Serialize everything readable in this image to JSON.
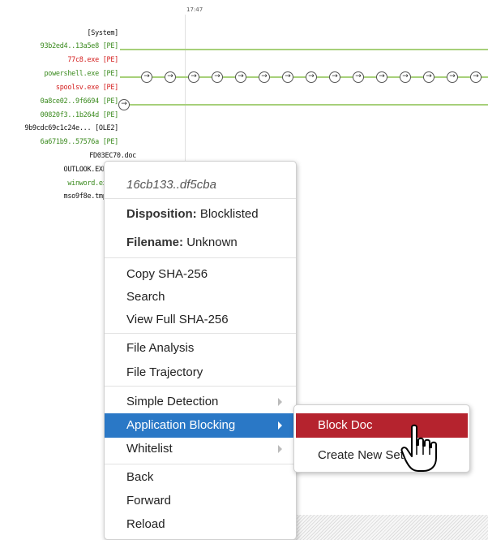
{
  "timeline": {
    "time": "17:47",
    "labels": [
      {
        "text": "[System]",
        "color": "black"
      },
      {
        "text": "93b2ed4..13a5e8 [PE]",
        "color": "green"
      },
      {
        "text": "77c8.exe [PE]",
        "color": "red"
      },
      {
        "text": "powershell.exe [PE]",
        "color": "green"
      },
      {
        "text": "spoolsv.exe [PE]",
        "color": "red"
      },
      {
        "text": "0a8ce02..9f6694 [PE]",
        "color": "green"
      },
      {
        "text": "00820f3..1b264d [PE]",
        "color": "green"
      },
      {
        "text": "9b9cdc69c1c24e... [OLE2]",
        "color": "black"
      },
      {
        "text": "6a671b9..57576a [PE]",
        "color": "green"
      },
      {
        "text": "FD03EC70.doc",
        "color": "black"
      },
      {
        "text": "OUTLOOK.EXE [P",
        "color": "black"
      },
      {
        "text": "winword.exe [",
        "color": "green"
      },
      {
        "text": "mso9f8e.tmp [Z",
        "color": "black"
      }
    ]
  },
  "context_menu": {
    "header": "16cb133..df5cba",
    "disposition_label": "Disposition:",
    "disposition_value": "Blocklisted",
    "filename_label": "Filename:",
    "filename_value": "Unknown",
    "copy_sha": "Copy SHA-256",
    "search": "Search",
    "view_sha": "View Full SHA-256",
    "file_analysis": "File Analysis",
    "file_trajectory": "File Trajectory",
    "simple_detection": "Simple Detection",
    "application_blocking": "Application Blocking",
    "whitelist": "Whitelist",
    "back": "Back",
    "forward": "Forward",
    "reload": "Reload"
  },
  "submenu": {
    "block_doc": "Block Doc",
    "create_new_set": "Create New Set"
  },
  "colors": {
    "highlight_blue": "#2a78c6",
    "highlight_red": "#b5232e",
    "track_green": "#a7d07a",
    "label_green": "#3a8a1e",
    "label_red": "#d42020"
  }
}
